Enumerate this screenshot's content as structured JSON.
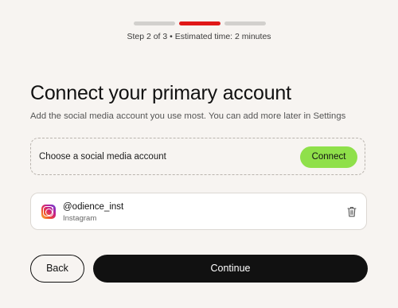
{
  "progress": {
    "total_steps": 3,
    "current_step": 2,
    "step_text": "Step 2 of 3 • Estimated time: 2 minutes",
    "colors": {
      "active": "#e01818",
      "inactive": "#d2d0cd"
    }
  },
  "header": {
    "title": "Connect your primary account",
    "subtitle": "Add the social media account you use most. You can add more later in Settings"
  },
  "chooser": {
    "label": "Choose a social media account",
    "connect_label": "Connect",
    "connect_color": "#8fe04a"
  },
  "account": {
    "handle": "@odience_inst",
    "platform": "Instagram",
    "icon": "instagram-icon",
    "remove_icon": "trash-icon"
  },
  "footer": {
    "back_label": "Back",
    "continue_label": "Continue"
  }
}
